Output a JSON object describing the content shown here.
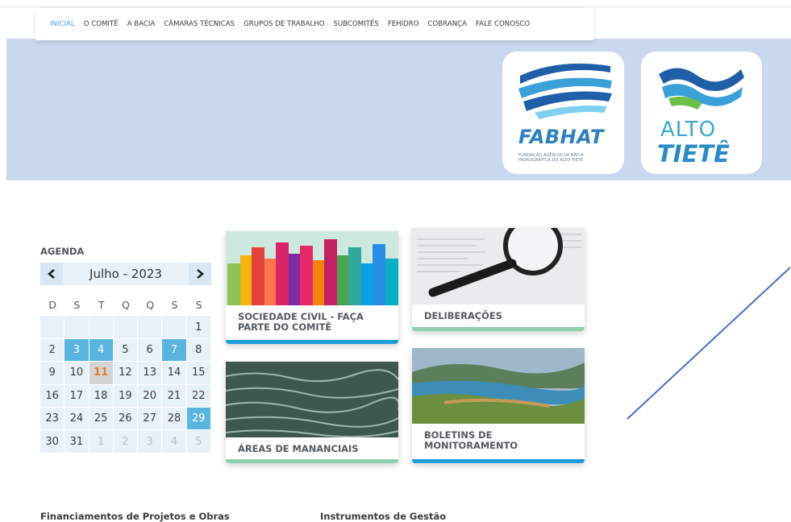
{
  "nav": {
    "items": [
      {
        "label": "INICIAL",
        "active": true
      },
      {
        "label": "O COMITÊ"
      },
      {
        "label": "A BACIA"
      },
      {
        "label": "CÂMARAS TÉCNICAS"
      },
      {
        "label": "GRUPOS DE TRABALHO"
      },
      {
        "label": "SUBCOMITÊS"
      },
      {
        "label": "FEHIDRO"
      },
      {
        "label": "COBRANÇA"
      },
      {
        "label": "FALE CONOSCO"
      }
    ]
  },
  "logos": {
    "fabhat": {
      "name": "FABHAT",
      "subtitle": "FUNDAÇÃO AGÊNCIA DA BACIA HIDROGRÁFICA DO ALTO TIETÊ"
    },
    "alto_tiete": {
      "line1": "ALTO",
      "line2": "TIETÊ"
    }
  },
  "agenda": {
    "title": "AGENDA",
    "month": "Julho - 2023",
    "prev_icon": "chevron-left-icon",
    "next_icon": "chevron-right-icon",
    "weekdays": [
      "D",
      "S",
      "T",
      "Q",
      "Q",
      "S",
      "S"
    ],
    "weeks": [
      [
        {
          "d": ""
        },
        {
          "d": ""
        },
        {
          "d": ""
        },
        {
          "d": ""
        },
        {
          "d": ""
        },
        {
          "d": ""
        },
        {
          "d": "1"
        }
      ],
      [
        {
          "d": "2"
        },
        {
          "d": "3",
          "hl": true
        },
        {
          "d": "4",
          "hl": true
        },
        {
          "d": "5"
        },
        {
          "d": "6"
        },
        {
          "d": "7",
          "hl": true
        },
        {
          "d": "8"
        }
      ],
      [
        {
          "d": "9"
        },
        {
          "d": "10"
        },
        {
          "d": "11",
          "today": true
        },
        {
          "d": "12"
        },
        {
          "d": "13"
        },
        {
          "d": "14"
        },
        {
          "d": "15"
        }
      ],
      [
        {
          "d": "16"
        },
        {
          "d": "17"
        },
        {
          "d": "18"
        },
        {
          "d": "19"
        },
        {
          "d": "20"
        },
        {
          "d": "21"
        },
        {
          "d": "22"
        }
      ],
      [
        {
          "d": "23"
        },
        {
          "d": "24"
        },
        {
          "d": "25"
        },
        {
          "d": "26"
        },
        {
          "d": "27"
        },
        {
          "d": "28"
        },
        {
          "d": "29",
          "hl": true
        }
      ],
      [
        {
          "d": "30"
        },
        {
          "d": "31"
        },
        {
          "d": "1",
          "muted": true
        },
        {
          "d": "2",
          "muted": true
        },
        {
          "d": "3",
          "muted": true
        },
        {
          "d": "4",
          "muted": true
        },
        {
          "d": "5",
          "muted": true
        }
      ]
    ]
  },
  "cards": {
    "sociedade": {
      "line1": "SOCIEDADE CIVIL - FAÇA",
      "line2": "PARTE DO COMITÊ"
    },
    "deliberacoes": {
      "line1": "DELIBERAÇÕES"
    },
    "areas": {
      "line1": "ÁREAS DE MANANCIAIS"
    },
    "boletins": {
      "line1": "BOLETINS DE",
      "line2": "MONITORAMENTO"
    }
  },
  "footer": {
    "left_title": "Financiamentos de Projetos e Obras",
    "right_title": "Instrumentos de Gestão"
  },
  "colors": {
    "accent": "#43a7de",
    "banner": "#c9d7ef",
    "calendar_highlight": "#59b5dd",
    "today_text": "#e07b2d"
  }
}
